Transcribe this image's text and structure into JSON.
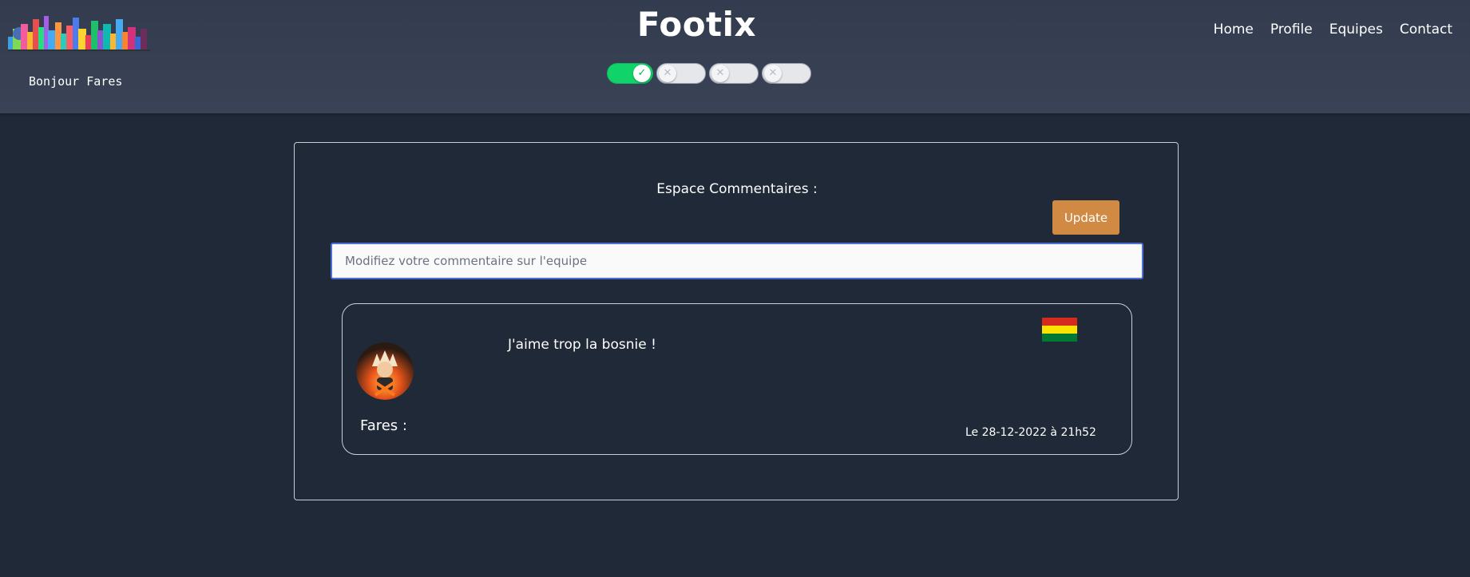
{
  "header": {
    "site_title": "Footix",
    "greeting": "Bonjour Fares",
    "nav": [
      "Home",
      "Profile",
      "Equipes",
      "Contact"
    ],
    "toggles": [
      {
        "state": "on",
        "icon": "check-icon"
      },
      {
        "state": "off",
        "icon": "x-icon"
      },
      {
        "state": "off",
        "icon": "x-icon"
      },
      {
        "state": "off",
        "icon": "x-icon"
      }
    ]
  },
  "comments_section": {
    "title": "Espace Commentaires :",
    "update_button": "Update",
    "input_placeholder": "Modifiez votre commentaire sur l'equipe",
    "input_value": ""
  },
  "comment": {
    "author": "Fares :",
    "text": "J'aime trop la bosnie !",
    "date": "Le 28-12-2022 à 21h52",
    "flag_colors": [
      "#d52b1e",
      "#f9e300",
      "#007934"
    ]
  },
  "colors": {
    "background": "#1f2937",
    "header": "#374151",
    "accent_button": "#d08a43",
    "toggle_on": "#10d46a"
  }
}
